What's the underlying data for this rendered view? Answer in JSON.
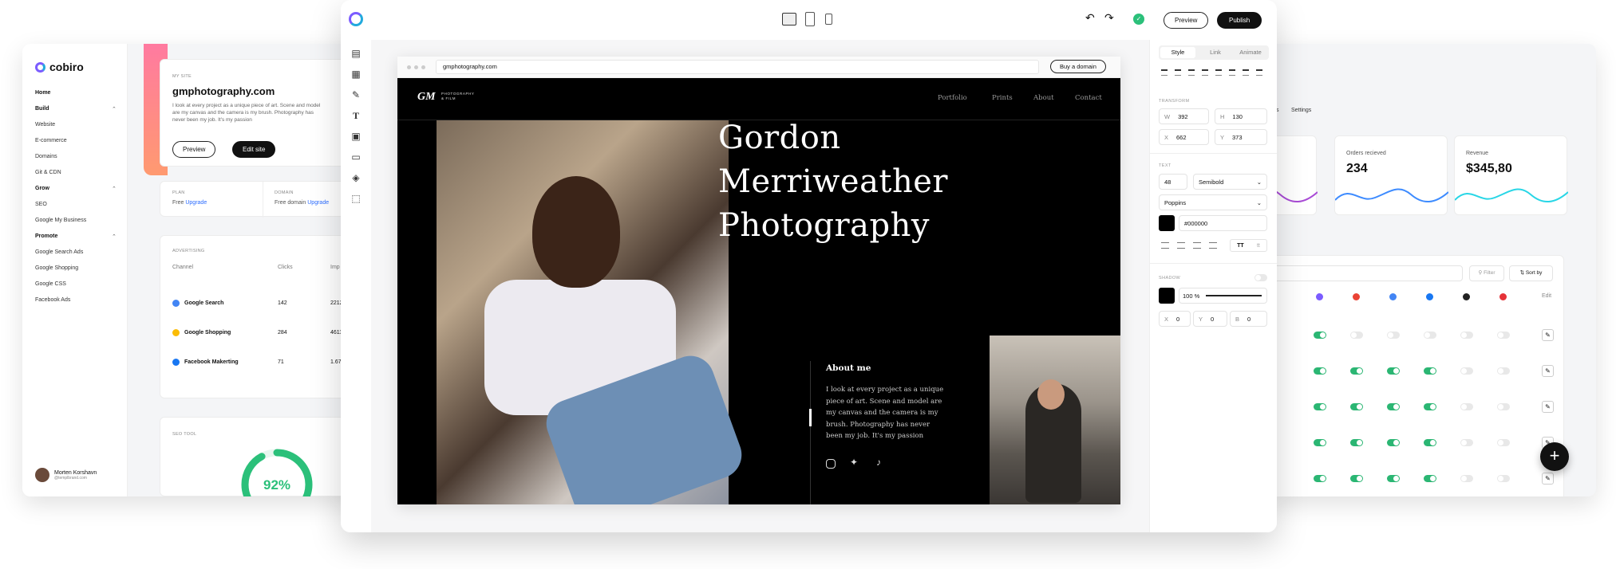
{
  "left_dashboard": {
    "brand": "cobiro",
    "nav": [
      {
        "label": "Home",
        "heading": true
      },
      {
        "label": "Build",
        "heading": true,
        "chevron": true
      },
      {
        "label": "Website"
      },
      {
        "label": "E-commerce"
      },
      {
        "label": "Domains"
      },
      {
        "label": "Git & CDN"
      },
      {
        "label": "Grow",
        "heading": true,
        "chevron": true
      },
      {
        "label": "SEO"
      },
      {
        "label": "Google My Business"
      },
      {
        "label": "Promote",
        "heading": true,
        "chevron": true
      },
      {
        "label": "Google Search Ads"
      },
      {
        "label": "Google Shopping"
      },
      {
        "label": "Google CSS"
      },
      {
        "label": "Facebook Ads"
      }
    ],
    "user": {
      "name": "Morten Korshavn",
      "email": "@templbrand.com"
    },
    "site": {
      "label": "MY SITE",
      "domain": "gmphotography.com",
      "description": "I look at every project as a unique piece of art. Scene and model are my canvas and the camera is my brush. Photography has never been my job. It's my passion",
      "preview": "Preview",
      "edit": "Edit site"
    },
    "plan": {
      "label": "PLAN",
      "value": "Free",
      "upgrade": "Upgrade"
    },
    "domain": {
      "label": "DOMAIN",
      "value": "Free domain",
      "upgrade": "Upgrade"
    },
    "ads": {
      "label": "ADVERTISING",
      "columns": [
        "Channel",
        "Clicks",
        "Imp"
      ],
      "rows": [
        {
          "channel": "Google Search",
          "clicks": "142",
          "imp": "2212"
        },
        {
          "channel": "Google Shopping",
          "clicks": "284",
          "imp": "4611"
        },
        {
          "channel": "Facebook Makerting",
          "clicks": "71",
          "imp": "1.67"
        }
      ]
    },
    "seo": {
      "label": "SEO TOOL",
      "score": "92%",
      "score_value": 0.92
    }
  },
  "right_dashboard": {
    "tabs_partial": "s",
    "settings_tab": "Settings",
    "stats": [
      {
        "title": "",
        "value": "",
        "color": "#a94bd6"
      },
      {
        "title": "Orders recieved",
        "value": "234",
        "color": "#3d8bff"
      },
      {
        "title": "Revenue",
        "value": "$345,80",
        "color": "#28d6e6"
      }
    ],
    "filter": "Filter",
    "sort": "Sort by",
    "edit_col": "Edit",
    "toggles": [
      [
        true,
        false,
        false,
        false,
        false,
        false,
        false
      ],
      [
        true,
        true,
        true,
        true,
        false,
        false,
        false
      ],
      [
        true,
        true,
        true,
        true,
        false,
        false,
        false
      ],
      [
        true,
        true,
        true,
        true,
        false,
        false,
        false
      ],
      [
        true,
        true,
        true,
        true,
        false,
        false,
        false
      ]
    ]
  },
  "editor": {
    "preview": "Preview",
    "publish": "Publish",
    "url": "gmphotography.com",
    "buy_domain": "Buy a domain",
    "site": {
      "logo": "GM",
      "logo_sub1": "PHOTOGRAPHY",
      "logo_sub2": "& FILM",
      "nav": [
        "Portfolio",
        "Prints",
        "About",
        "Contact"
      ],
      "title_line1": "Gordon",
      "title_line2": "Merriweather",
      "title_line3": "Photography",
      "about_heading": "About me",
      "about_text": "I look at every project as a unique piece of art. Scene and model are my canvas and the camera is my brush. Photography has never been my job. It's my passion"
    },
    "props": {
      "tabs": [
        "Style",
        "Link",
        "Animate"
      ],
      "transform_label": "TRANSFORM",
      "w": "392",
      "h": "130",
      "x": "662",
      "y": "373",
      "text_label": "TEXT",
      "font_size": "48",
      "weight": "Semibold",
      "font": "Poppins",
      "color": "#000000",
      "tt": "TT",
      "tt2": "tt",
      "shadow_label": "SHADOW",
      "opacity": "100 %",
      "sx": "0",
      "sy": "0",
      "sb": "0"
    }
  }
}
